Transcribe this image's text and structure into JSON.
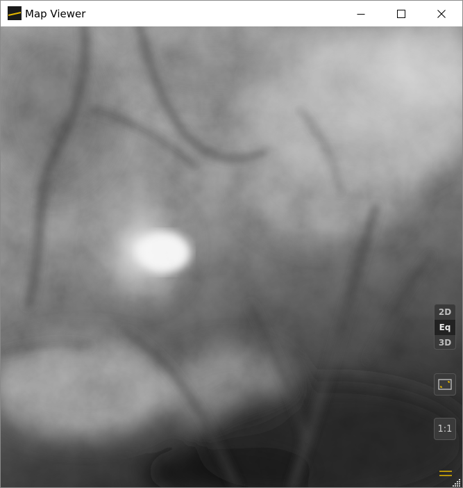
{
  "window": {
    "title": "Map Viewer",
    "controls": [
      "minimize",
      "maximize",
      "close"
    ]
  },
  "map": {
    "type": "elevation-grayscale-heightmap"
  },
  "view_modes": {
    "options": [
      "2D",
      "Eq",
      "3D"
    ],
    "selected": "Eq"
  },
  "toolbar": {
    "fit_icon": "fit-to-view-icon",
    "ratio_label": "1:1",
    "menu_icon": "hamburger-menu-icon"
  },
  "colors": {
    "accent": "#e6b800",
    "panel": "#3a3a3a",
    "app_icon_bg": "#1a1a1a"
  }
}
